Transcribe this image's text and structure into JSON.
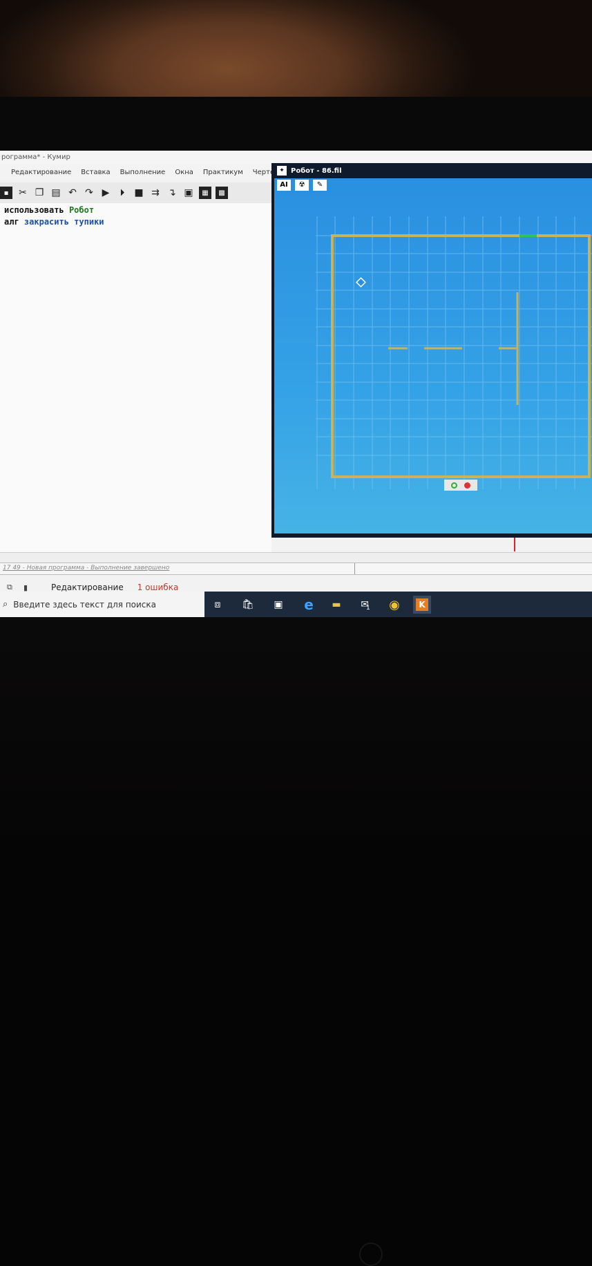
{
  "window": {
    "title": "рограмма* - Кумир"
  },
  "menu": {
    "items": [
      "Редактирование",
      "Вставка",
      "Выполнение",
      "Окна",
      "Практикум",
      "Чертежн"
    ]
  },
  "editor": {
    "line1_keyword": "использовать",
    "line1_name": "Робот",
    "line2_keyword": "алг",
    "line2_name": "закрасить тупики"
  },
  "status": {
    "message": "17 49 - Новая программа - Выполнение завершено",
    "mode": "Редактирование",
    "errors": "1 ошибка"
  },
  "robot_window": {
    "title": "Робот - 86.fil",
    "toolbar": [
      "AI",
      "radiation-icon",
      "pen-icon"
    ]
  },
  "taskbar": {
    "search_placeholder": "Введите здесь текст для поиска",
    "mail_badge": "1",
    "app_letter": "K"
  },
  "colors": {
    "field_blue": "#2a8fe0",
    "wall": "#c8b25a",
    "painted_edge": "#2ec25a",
    "robot_marker": "#ffffff",
    "error_red": "#c0392b",
    "taskbar": "#1d2a3c"
  }
}
